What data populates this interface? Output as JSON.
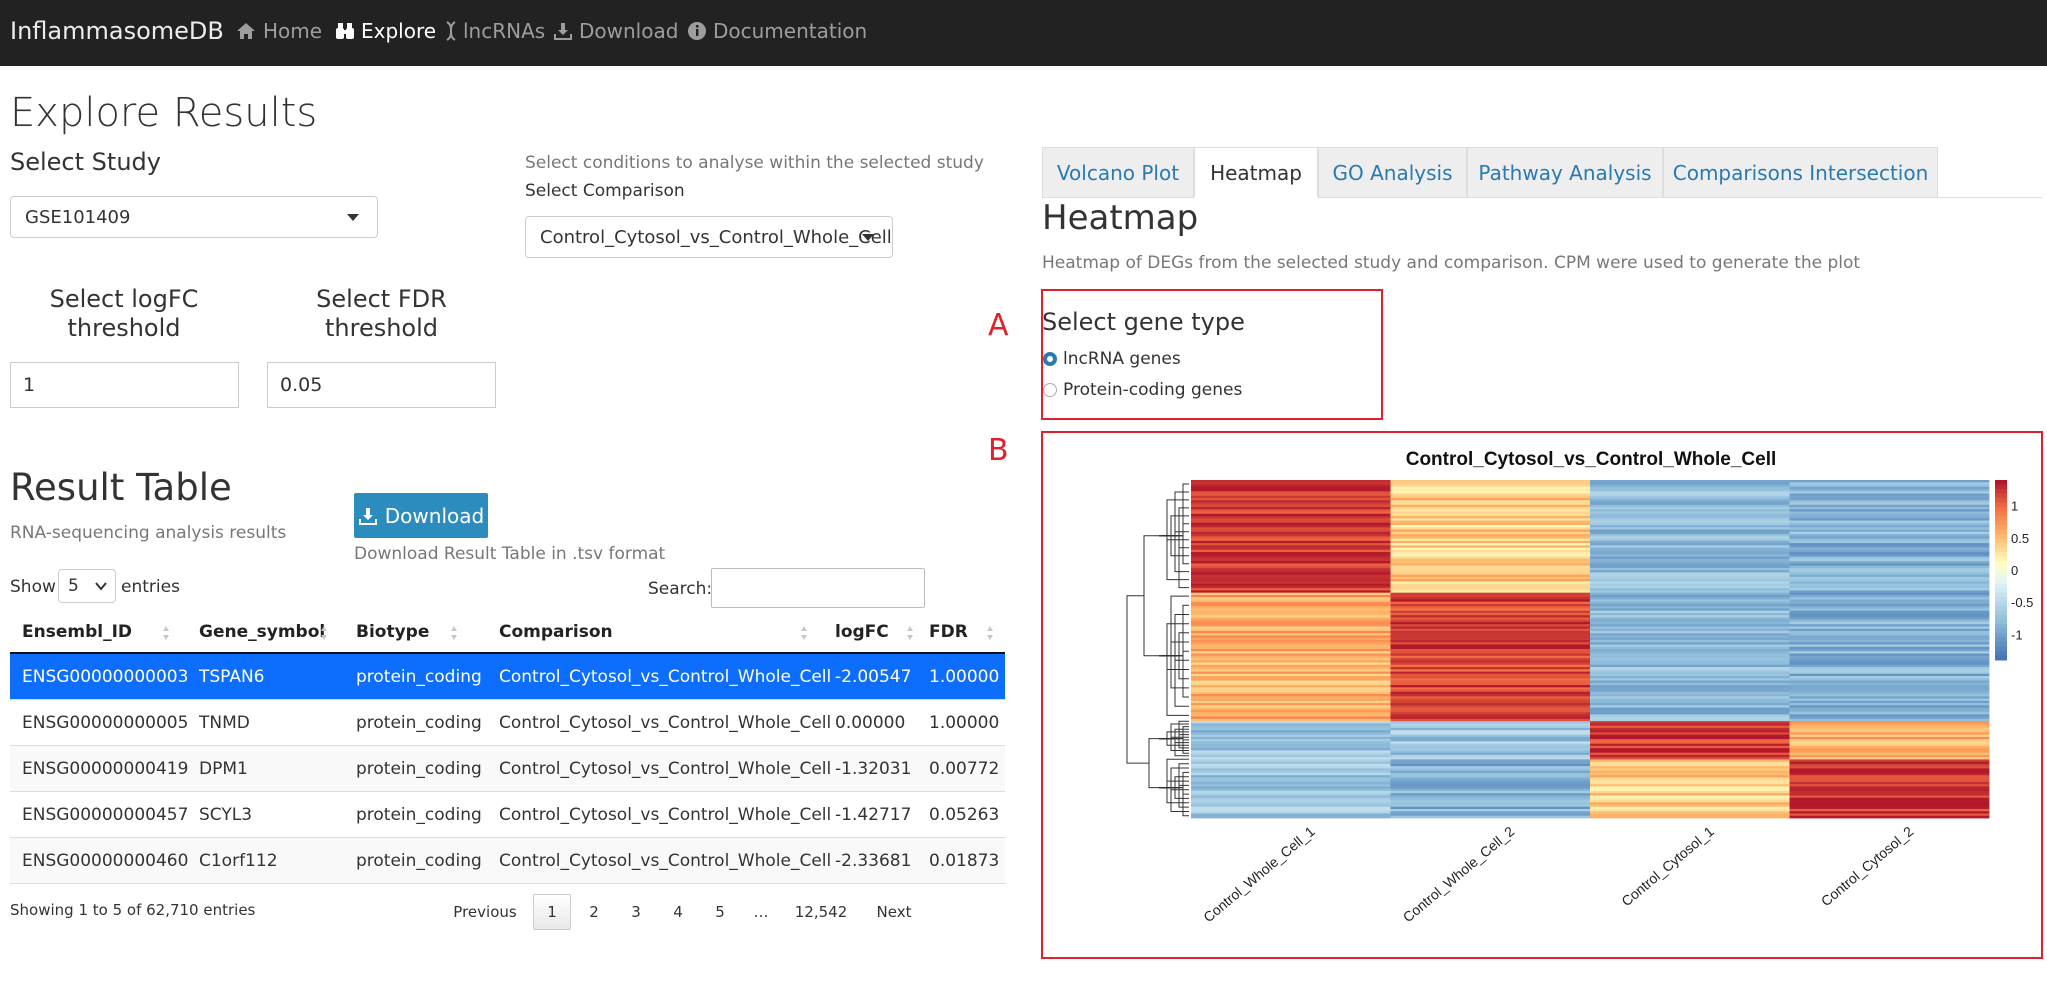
{
  "navbar": {
    "brand": "InflammasomeDB",
    "items": [
      {
        "label": "Home",
        "icon": "home-icon"
      },
      {
        "label": "Explore",
        "icon": "binoculars-icon"
      },
      {
        "label": "lncRNAs",
        "icon": "dna-icon"
      },
      {
        "label": "Download",
        "icon": "download-icon"
      },
      {
        "label": "Documentation",
        "icon": "info-icon"
      }
    ],
    "active": "Explore"
  },
  "page": {
    "title": "Explore Results"
  },
  "study": {
    "label": "Select Study",
    "value": "GSE101409"
  },
  "comparison": {
    "hint": "Select conditions to analyse within the selected study",
    "label": "Select Comparison",
    "value": "Control_Cytosol_vs_Control_Whole_Cell"
  },
  "thresholds": {
    "logfc_label": "Select logFC threshold",
    "logfc_value": "1",
    "fdr_label": "Select FDR threshold",
    "fdr_value": "0.05"
  },
  "result": {
    "title": "Result Table",
    "subtitle": "RNA-sequencing analysis results",
    "download_label": "Download",
    "download_hint": "Download Result Table in .tsv format",
    "show_label": "Show",
    "entries_value": "5",
    "entries_label": "entries",
    "search_label": "Search:",
    "search_value": ""
  },
  "table": {
    "columns": [
      "Ensembl_ID",
      "Gene_symbol",
      "Biotype",
      "Comparison",
      "logFC",
      "FDR"
    ],
    "rows": [
      [
        "ENSG00000000003",
        "TSPAN6",
        "protein_coding",
        "Control_Cytosol_vs_Control_Whole_Cell",
        "-2.00547",
        "1.00000"
      ],
      [
        "ENSG00000000005",
        "TNMD",
        "protein_coding",
        "Control_Cytosol_vs_Control_Whole_Cell",
        "0.00000",
        "1.00000"
      ],
      [
        "ENSG00000000419",
        "DPM1",
        "protein_coding",
        "Control_Cytosol_vs_Control_Whole_Cell",
        "-1.32031",
        "0.00772"
      ],
      [
        "ENSG00000000457",
        "SCYL3",
        "protein_coding",
        "Control_Cytosol_vs_Control_Whole_Cell",
        "-1.42717",
        "0.05263"
      ],
      [
        "ENSG00000000460",
        "C1orf112",
        "protein_coding",
        "Control_Cytosol_vs_Control_Whole_Cell",
        "-2.33681",
        "0.01873"
      ]
    ],
    "selected_row": 0,
    "info": "Showing 1 to 5 of 62,710 entries"
  },
  "pagination": {
    "previous": "Previous",
    "pages": [
      "1",
      "2",
      "3",
      "4",
      "5",
      "…",
      "12,542"
    ],
    "current": "1",
    "next": "Next"
  },
  "tabs": {
    "items": [
      "Volcano Plot",
      "Heatmap",
      "GO Analysis",
      "Pathway Analysis",
      "Comparisons Intersection"
    ],
    "active": "Heatmap"
  },
  "heatmap_panel": {
    "title": "Heatmap",
    "description": "Heatmap of DEGs from the selected study and comparison. CPM were used to generate the plot",
    "gene_type_label": "Select gene type",
    "gene_types": [
      "lncRNA genes",
      "Protein-coding genes"
    ],
    "selected_gene_type": "lncRNA genes",
    "annotation_a": "A",
    "annotation_b": "B"
  },
  "colors": {
    "navbar_bg": "#222222",
    "link": "#2a7ab0",
    "selected_row": "#0d6efd",
    "download_button": "#2c8cbd",
    "annotation_red": "#e0202a",
    "heat_high": "#b2182b",
    "heat_mid": "#ffffbf",
    "heat_low": "#4575b4"
  },
  "chart_data": {
    "type": "heatmap",
    "title": "Control_Cytosol_vs_Control_Whole_Cell",
    "columns": [
      "Control_Whole_Cell_1",
      "Control_Whole_Cell_2",
      "Control_Cytosol_1",
      "Control_Cytosol_2"
    ],
    "row_clusters": [
      {
        "fraction": 0.33,
        "values": [
          1.3,
          0.4,
          -0.8,
          -0.9
        ]
      },
      {
        "fraction": 0.38,
        "values": [
          0.6,
          1.2,
          -0.8,
          -0.9
        ]
      },
      {
        "fraction": 0.11,
        "values": [
          -0.7,
          -0.7,
          1.3,
          0.6
        ]
      },
      {
        "fraction": 0.18,
        "values": [
          -0.7,
          -0.9,
          0.4,
          1.3
        ]
      }
    ],
    "colorbar_ticks": [
      "1",
      "0.5",
      "0",
      "-0.5",
      "-1"
    ],
    "colorbar_values": [
      1,
      0.5,
      0,
      -0.5,
      -1
    ],
    "color_range": [
      -1.4,
      1.4
    ],
    "legend_position": "right"
  }
}
